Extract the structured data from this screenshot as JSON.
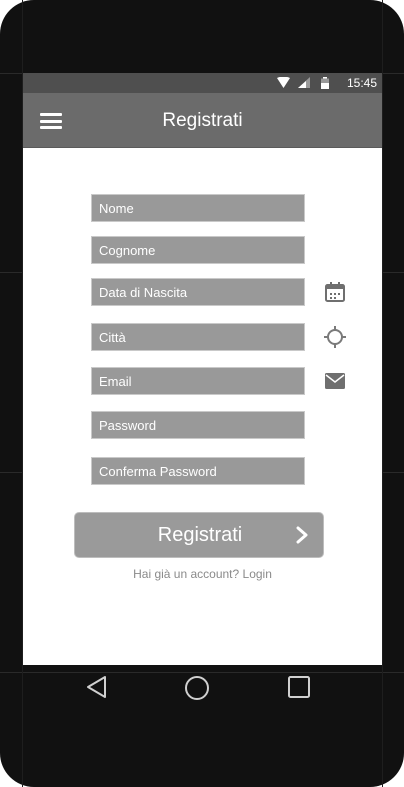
{
  "status_bar": {
    "time": "15:45"
  },
  "app_bar": {
    "title": "Registrati",
    "menu_icon": "hamburger-menu-icon"
  },
  "form": {
    "fields": [
      {
        "placeholder": "Nome",
        "icon": ""
      },
      {
        "placeholder": "Cognome",
        "icon": ""
      },
      {
        "placeholder": "Data di Nascita",
        "icon": "calendar-icon"
      },
      {
        "placeholder": "Città",
        "icon": "location-target-icon"
      },
      {
        "placeholder": "Email",
        "icon": "email-envelope-icon"
      },
      {
        "placeholder": "Password",
        "icon": ""
      },
      {
        "placeholder": "Conferma Password",
        "icon": ""
      }
    ],
    "submit_label": "Registrati",
    "submit_icon": "chevron-right-icon",
    "login_text": "Hai già un account? Login"
  },
  "nav_bar": {
    "icons": [
      "back-icon",
      "home-icon",
      "recent-apps-icon"
    ]
  },
  "colors": {
    "app_bar": "#6b6b6b",
    "status_bar": "#4f4f4f",
    "field_bg": "#999999",
    "button_bg": "#9a9a9a",
    "frame": "#111111"
  }
}
